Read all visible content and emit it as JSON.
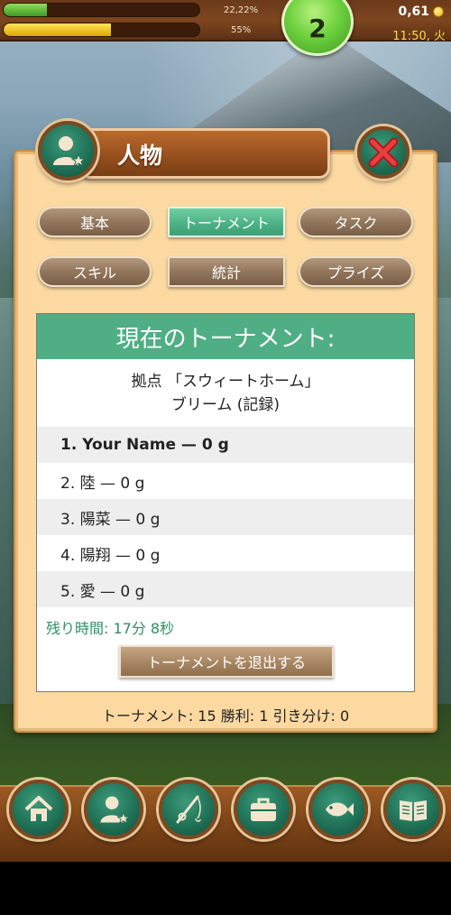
{
  "status": {
    "xp_percent_label": "22,22%",
    "xp_fraction": 0.2222,
    "energy_percent_label": "55%",
    "energy_fraction": 0.55,
    "level": "2",
    "money": "0,61",
    "time": "11:50, 火"
  },
  "panel": {
    "title": "人物",
    "tabs": [
      {
        "label": "基本",
        "active": false
      },
      {
        "label": "トーナメント",
        "active": true
      },
      {
        "label": "タスク",
        "active": false
      },
      {
        "label": "スキル",
        "active": false
      },
      {
        "label": "統計",
        "active": false
      },
      {
        "label": "プライズ",
        "active": false
      }
    ]
  },
  "tournament": {
    "header": "現在のトーナメント:",
    "location": "拠点 「スウィートホーム」",
    "target": "ブリーム (記録)",
    "ranking": [
      "1. Your Name — 0 g",
      "2. 陸 — 0 g",
      "3. 陽菜 — 0 g",
      "4. 陽翔 — 0 g",
      "5. 愛 — 0 g"
    ],
    "time_left": "残り時間: 17分 8秒",
    "leave_label": "トーナメントを退出する"
  },
  "stats_line": "トーナメント: 15  勝利: 1  引き分け: 0",
  "nav": [
    "home-icon",
    "profile-icon",
    "fishing-rod-icon",
    "briefcase-icon",
    "fish-icon",
    "book-icon"
  ],
  "colors": {
    "accent_green": "#4fae84",
    "panel_bg": "#fbd9a1",
    "time_left_text": "#2f8d63"
  }
}
